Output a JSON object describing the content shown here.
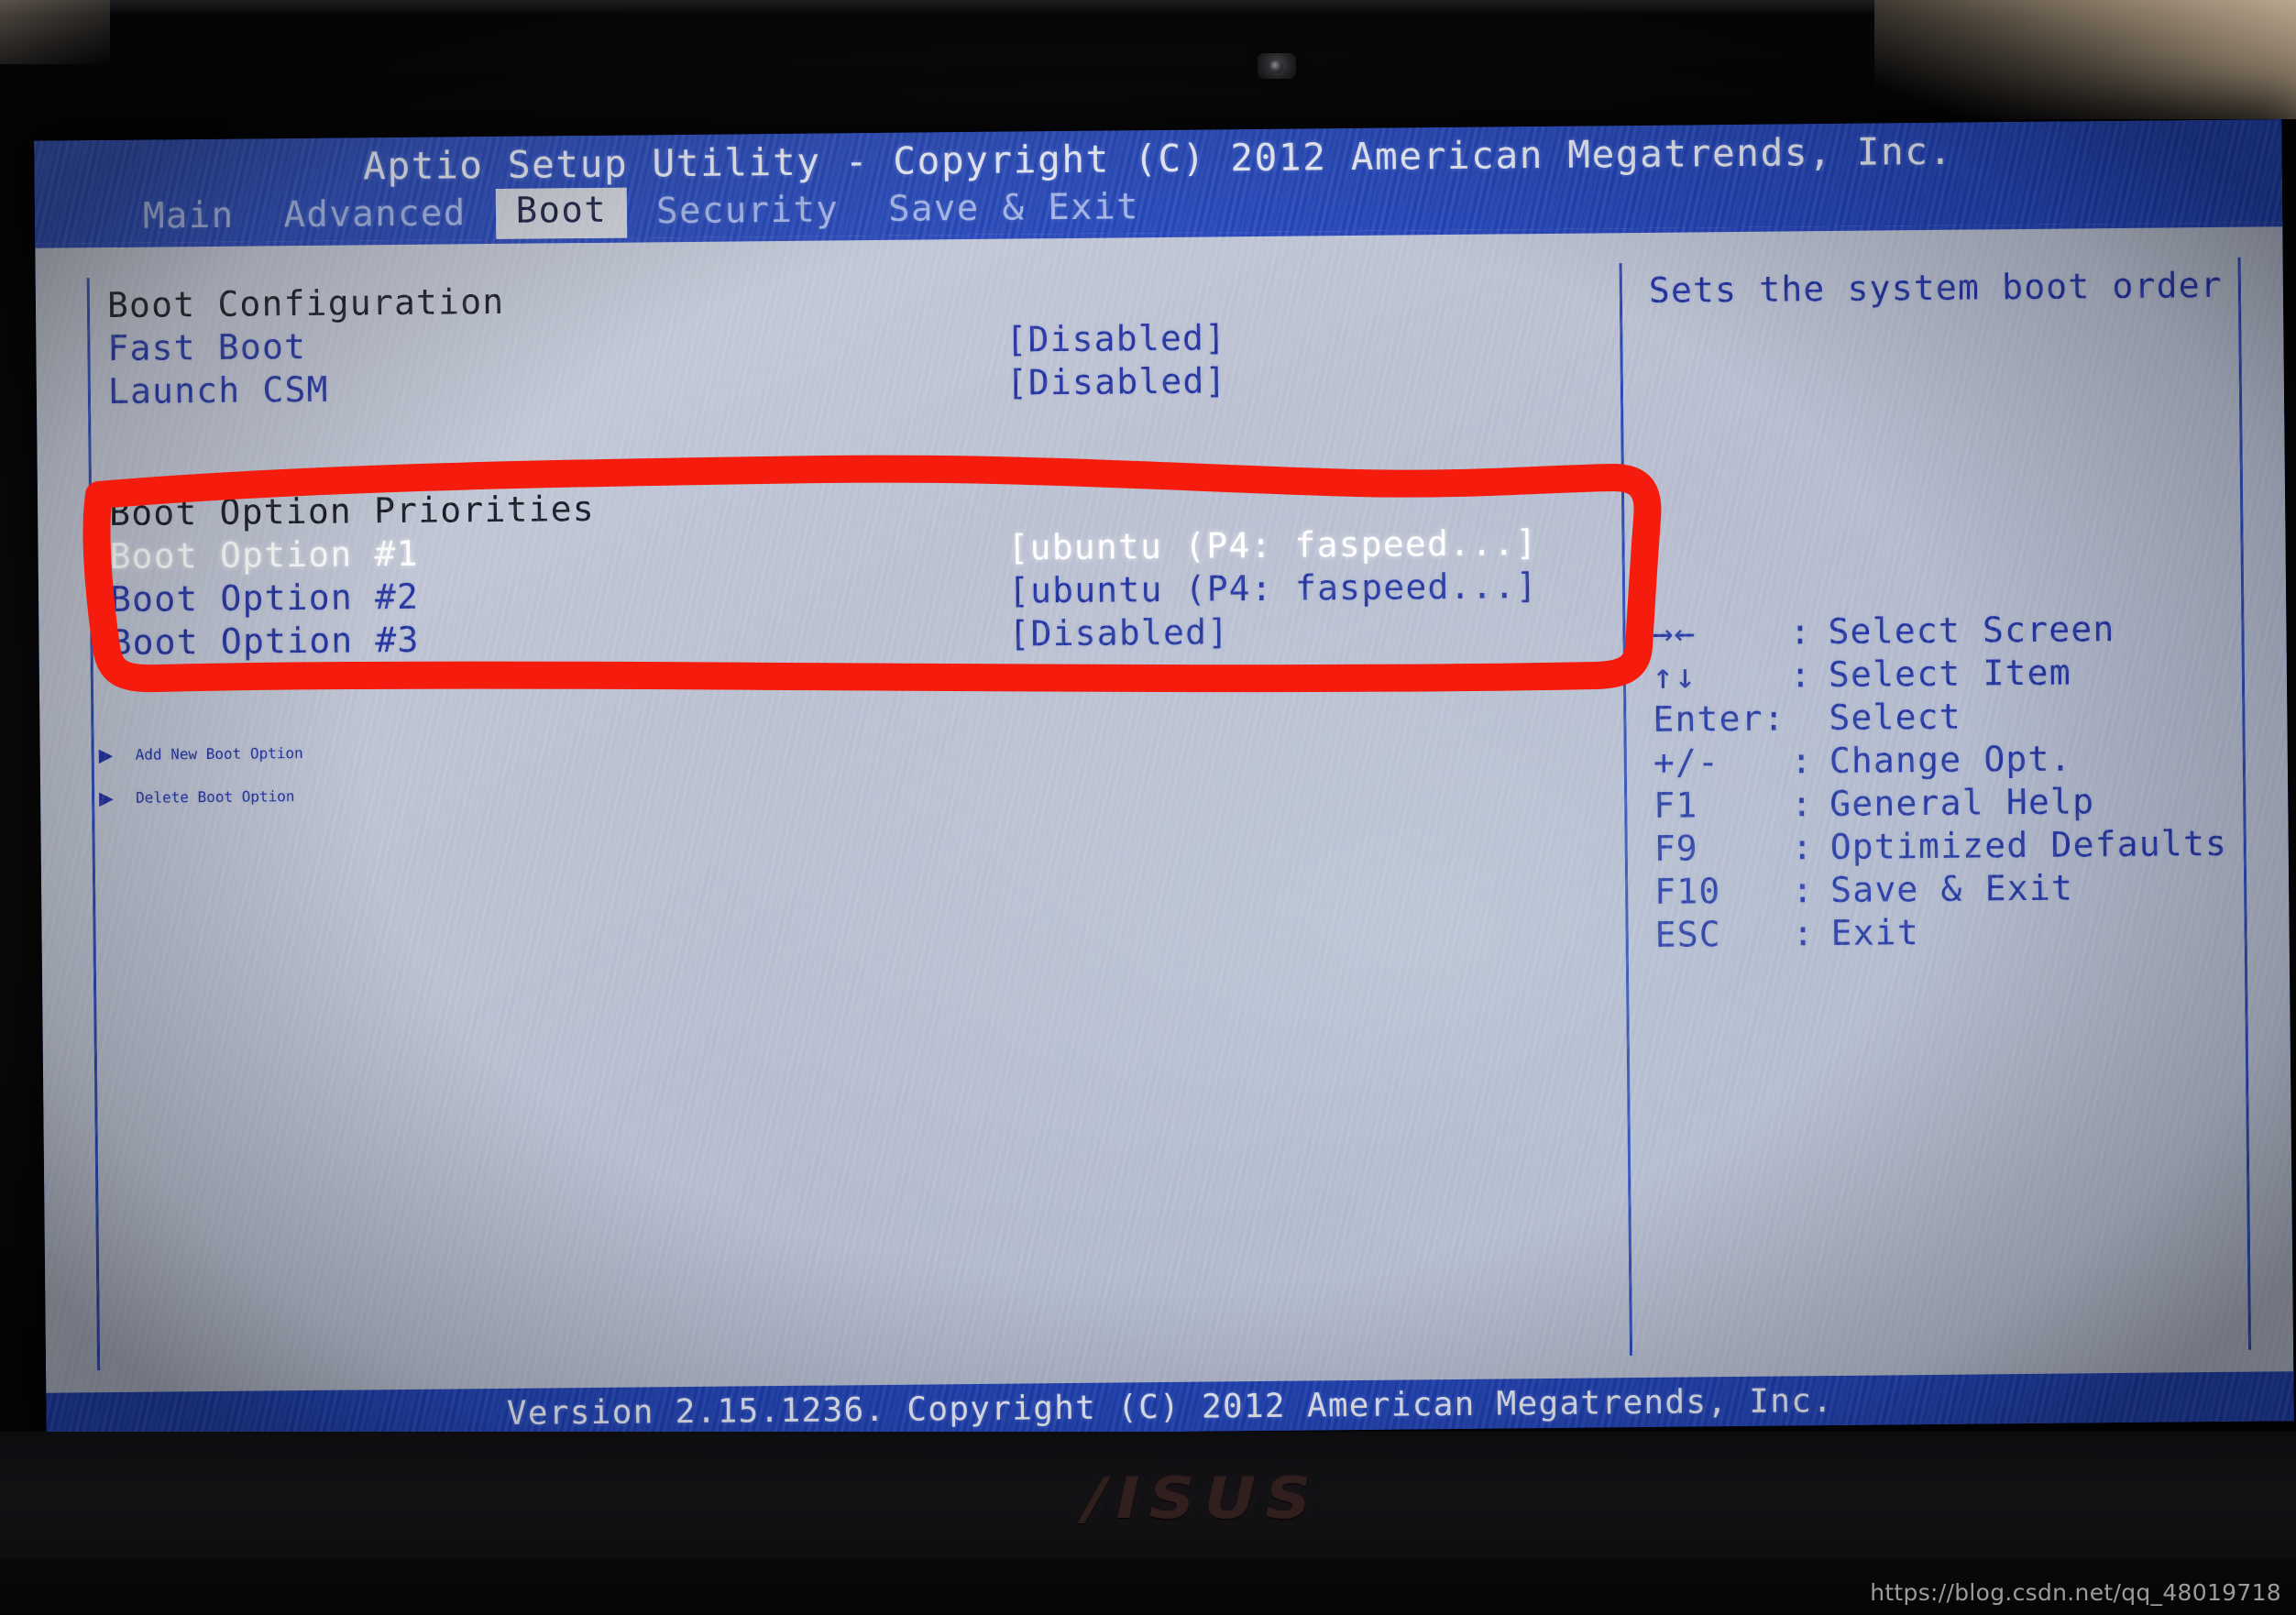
{
  "bios": {
    "title": "Aptio Setup Utility - Copyright (C) 2012 American Megatrends, Inc.",
    "footer": "Version 2.15.1236. Copyright (C) 2012 American Megatrends, Inc.",
    "tabs": [
      {
        "label": "Main",
        "selected": false
      },
      {
        "label": "Advanced",
        "selected": false
      },
      {
        "label": "Boot",
        "selected": true
      },
      {
        "label": "Security",
        "selected": false
      },
      {
        "label": "Save & Exit",
        "selected": false
      }
    ],
    "sections": {
      "boot_configuration": {
        "heading": "Boot Configuration",
        "items": [
          {
            "label": "Fast Boot",
            "value": "[Disabled]"
          },
          {
            "label": "Launch CSM",
            "value": "[Disabled]"
          }
        ]
      },
      "boot_option_priorities": {
        "heading": "Boot Option Priorities",
        "items": [
          {
            "label": "Boot Option #1",
            "value": "[ubuntu (P4: faspeed...]",
            "highlighted": true
          },
          {
            "label": "Boot Option #2",
            "value": "[ubuntu (P4: faspeed...]",
            "highlighted": false
          },
          {
            "label": "Boot Option #3",
            "value": "[Disabled]",
            "highlighted": false
          }
        ]
      },
      "submenus": [
        {
          "marker": "▶",
          "label": "Add New Boot Option"
        },
        {
          "marker": "▶",
          "label": "Delete Boot Option"
        }
      ]
    },
    "help": {
      "text": "Sets the system boot order",
      "keys": [
        {
          "key": "→←",
          "sep": ":",
          "action": "Select Screen"
        },
        {
          "key": "↑↓",
          "sep": ":",
          "action": "Select Item"
        },
        {
          "key": "Enter:",
          "sep": "",
          "action": "Select"
        },
        {
          "key": "+/-",
          "sep": ":",
          "action": "Change Opt."
        },
        {
          "key": "F1",
          "sep": ":",
          "action": "General Help"
        },
        {
          "key": "F9",
          "sep": ":",
          "action": "Optimized Defaults"
        },
        {
          "key": "F10",
          "sep": ":",
          "action": "Save & Exit"
        },
        {
          "key": "ESC",
          "sep": ":",
          "action": "Exit"
        }
      ]
    }
  },
  "hardware": {
    "brand_logo": "/ISUS"
  },
  "overlay": {
    "watermark": "https://blog.csdn.net/qq_48019718",
    "annotation_color": "#f51b0d"
  }
}
